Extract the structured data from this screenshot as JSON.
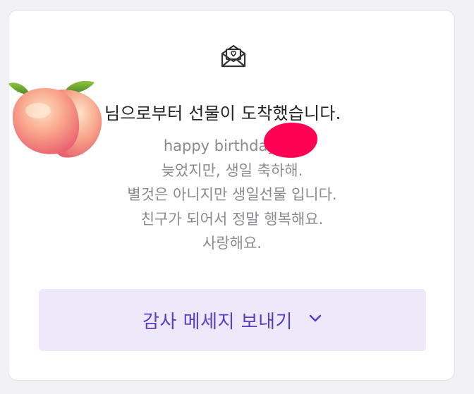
{
  "gift_card": {
    "icon": "envelope-heart-icon",
    "avatar_icon": "peach-emoji",
    "title": "님으로부터 선물이 도착했습니다.",
    "message_lines": [
      "happy birthday      씨!",
      "늦었지만, 생일 축하해.",
      "별것은 아니지만 생일선물 입니다.",
      "친구가 되어서 정말 행복해요.",
      "사랑해요."
    ],
    "thanks_button": {
      "label": "감사 메세지 보내기",
      "icon": "chevron-down-icon"
    }
  },
  "colors": {
    "accent": "#5b3cc4",
    "button_bg": "#ede9fb",
    "redaction": "#ff0055",
    "message_text": "#8a8a8f",
    "title_text": "#222226"
  }
}
